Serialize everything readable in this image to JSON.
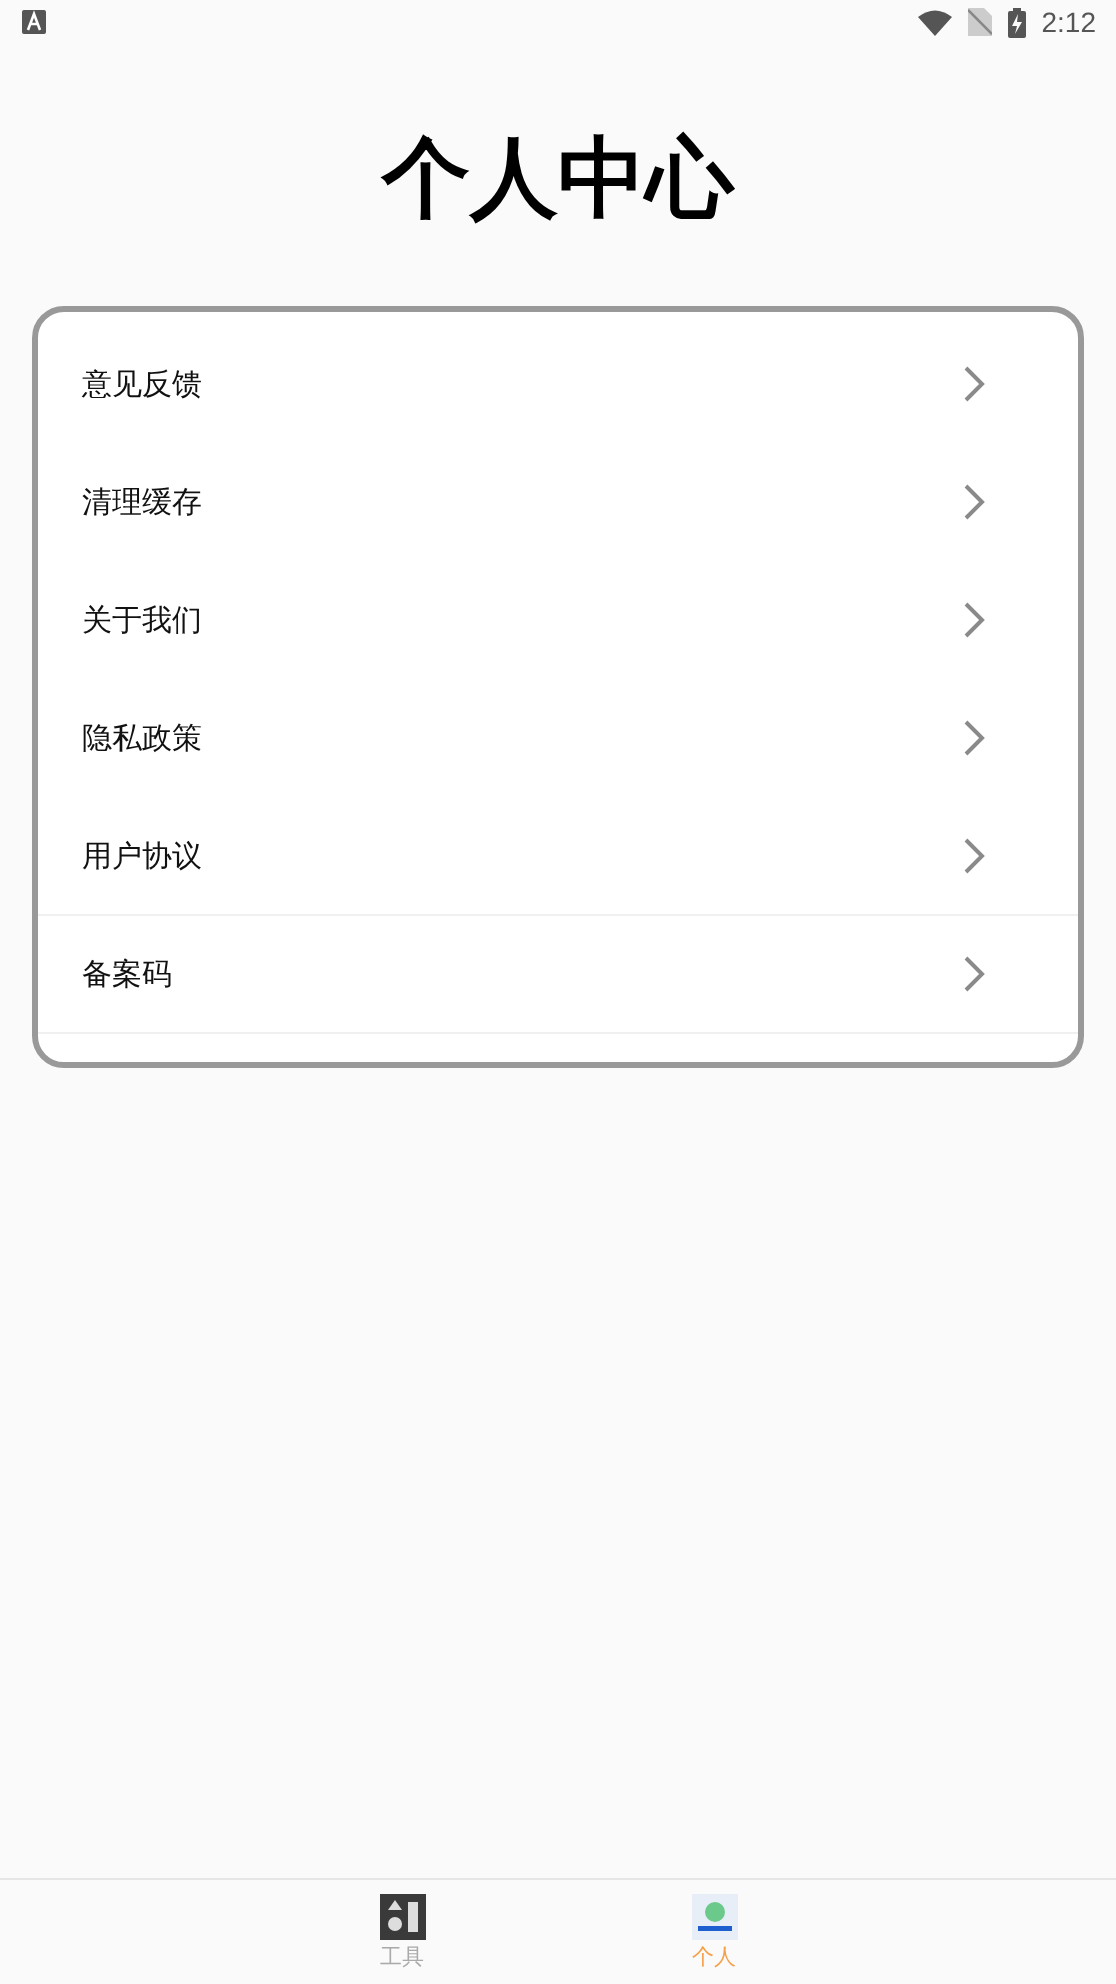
{
  "status_bar": {
    "time": "2:12"
  },
  "title": "个人中心",
  "menu": [
    {
      "label": "意见反馈",
      "divider": false
    },
    {
      "label": "清理缓存",
      "divider": false
    },
    {
      "label": "关于我们",
      "divider": false
    },
    {
      "label": "隐私政策",
      "divider": false
    },
    {
      "label": "用户协议",
      "divider": true
    },
    {
      "label": "备案码",
      "divider": true
    }
  ],
  "bottom_nav": [
    {
      "label": "工具",
      "selected": false,
      "kind": "tools"
    },
    {
      "label": "个人",
      "selected": true,
      "kind": "profile"
    }
  ]
}
